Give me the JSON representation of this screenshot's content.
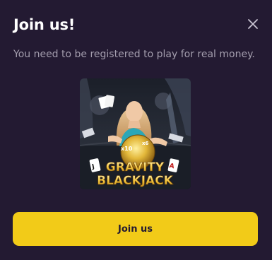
{
  "dialog": {
    "title": "Join us!",
    "message": "You need to be registered to play for real money.",
    "close_icon": "close-icon",
    "join_button_label": "Join us"
  },
  "game": {
    "title_line1": "GRAVITY",
    "title_line2": "BLACKJACK",
    "multiplier_badge_1": "x10",
    "multiplier_badge_2": "x6"
  },
  "colors": {
    "background": "#231a32",
    "title": "#ffffff",
    "message": "#a49eae",
    "button": "#f2cb18",
    "button_text": "#231a32"
  }
}
